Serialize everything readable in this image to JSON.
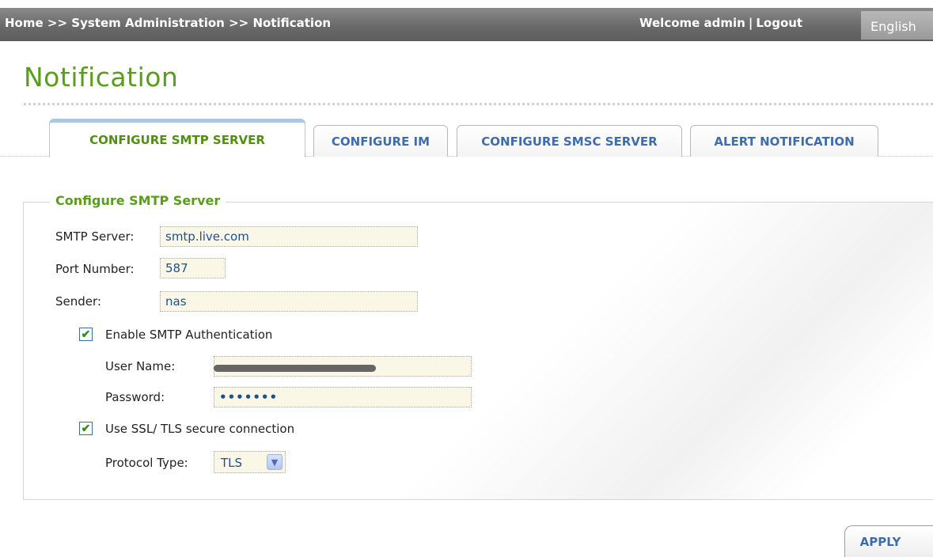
{
  "header": {
    "breadcrumb": {
      "home": "Home",
      "separator": ">>",
      "section": "System Administration",
      "current": "Notification"
    },
    "welcome": "Welcome admin",
    "separator": "|",
    "logout": "Logout",
    "language": "English"
  },
  "page": {
    "title": "Notification"
  },
  "tabs": [
    {
      "label": "CONFIGURE SMTP SERVER",
      "active": true
    },
    {
      "label": "CONFIGURE IM",
      "active": false
    },
    {
      "label": "CONFIGURE SMSC SERVER",
      "active": false
    },
    {
      "label": "ALERT NOTIFICATION",
      "active": false
    }
  ],
  "form": {
    "legend": "Configure SMTP Server",
    "smtp_server": {
      "label": "SMTP Server:",
      "value": "smtp.live.com"
    },
    "port_number": {
      "label": "Port Number:",
      "value": "587"
    },
    "sender": {
      "label": "Sender:",
      "value": "nas"
    },
    "enable_auth": {
      "label": "Enable SMTP Authentication",
      "checked": true
    },
    "user_name": {
      "label": "User Name:",
      "value": ""
    },
    "password": {
      "label": "Password:",
      "value": "•••••••"
    },
    "use_ssl": {
      "label": "Use SSL/ TLS secure connection",
      "checked": true
    },
    "protocol_type": {
      "label": "Protocol Type:",
      "value": "TLS"
    }
  },
  "actions": {
    "apply": "APPLY"
  },
  "colors": {
    "accent_green": "#5a9d1c",
    "tab_blue": "#3d6dad",
    "input_bg": "#fbf7e6"
  }
}
